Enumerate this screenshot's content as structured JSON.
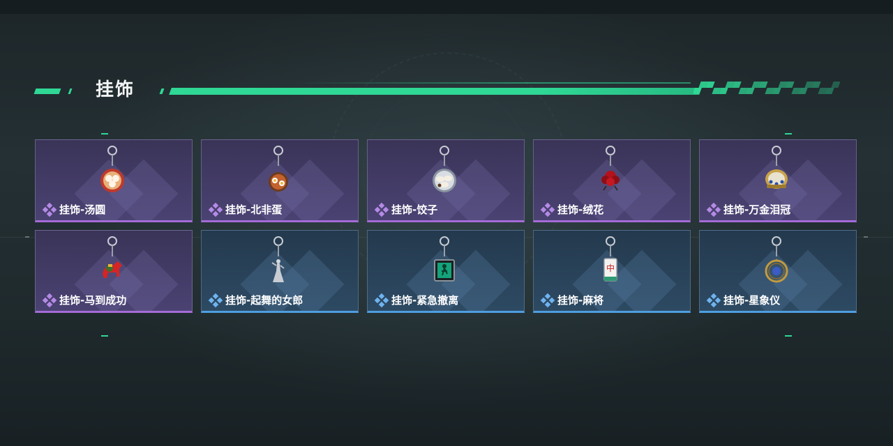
{
  "section": {
    "title": "挂饰"
  },
  "colors": {
    "accent_green": "#2fd895",
    "rarity_purple": "#a56bd8",
    "rarity_blue": "#4e9ee0"
  },
  "items": [
    {
      "name": "挂饰-汤圆",
      "rarity": "purple",
      "icon": "tangyuan-bowl-icon"
    },
    {
      "name": "挂饰-北非蛋",
      "rarity": "purple",
      "icon": "shakshuka-pan-icon"
    },
    {
      "name": "挂饰-饺子",
      "rarity": "purple",
      "icon": "dumpling-plate-icon"
    },
    {
      "name": "挂饰-绒花",
      "rarity": "purple",
      "icon": "velvet-flower-icon"
    },
    {
      "name": "挂饰-万金泪冠",
      "rarity": "purple",
      "icon": "jeweled-crown-icon"
    },
    {
      "name": "挂饰-马到成功",
      "rarity": "purple",
      "icon": "red-horse-icon"
    },
    {
      "name": "挂饰-起舞的女郎",
      "rarity": "blue",
      "icon": "dancing-lady-icon"
    },
    {
      "name": "挂饰-紧急撤离",
      "rarity": "blue",
      "icon": "emergency-exit-sign-icon"
    },
    {
      "name": "挂饰-麻将",
      "rarity": "blue",
      "icon": "mahjong-tile-icon"
    },
    {
      "name": "挂饰-星象仪",
      "rarity": "blue",
      "icon": "astrolabe-icon"
    }
  ]
}
